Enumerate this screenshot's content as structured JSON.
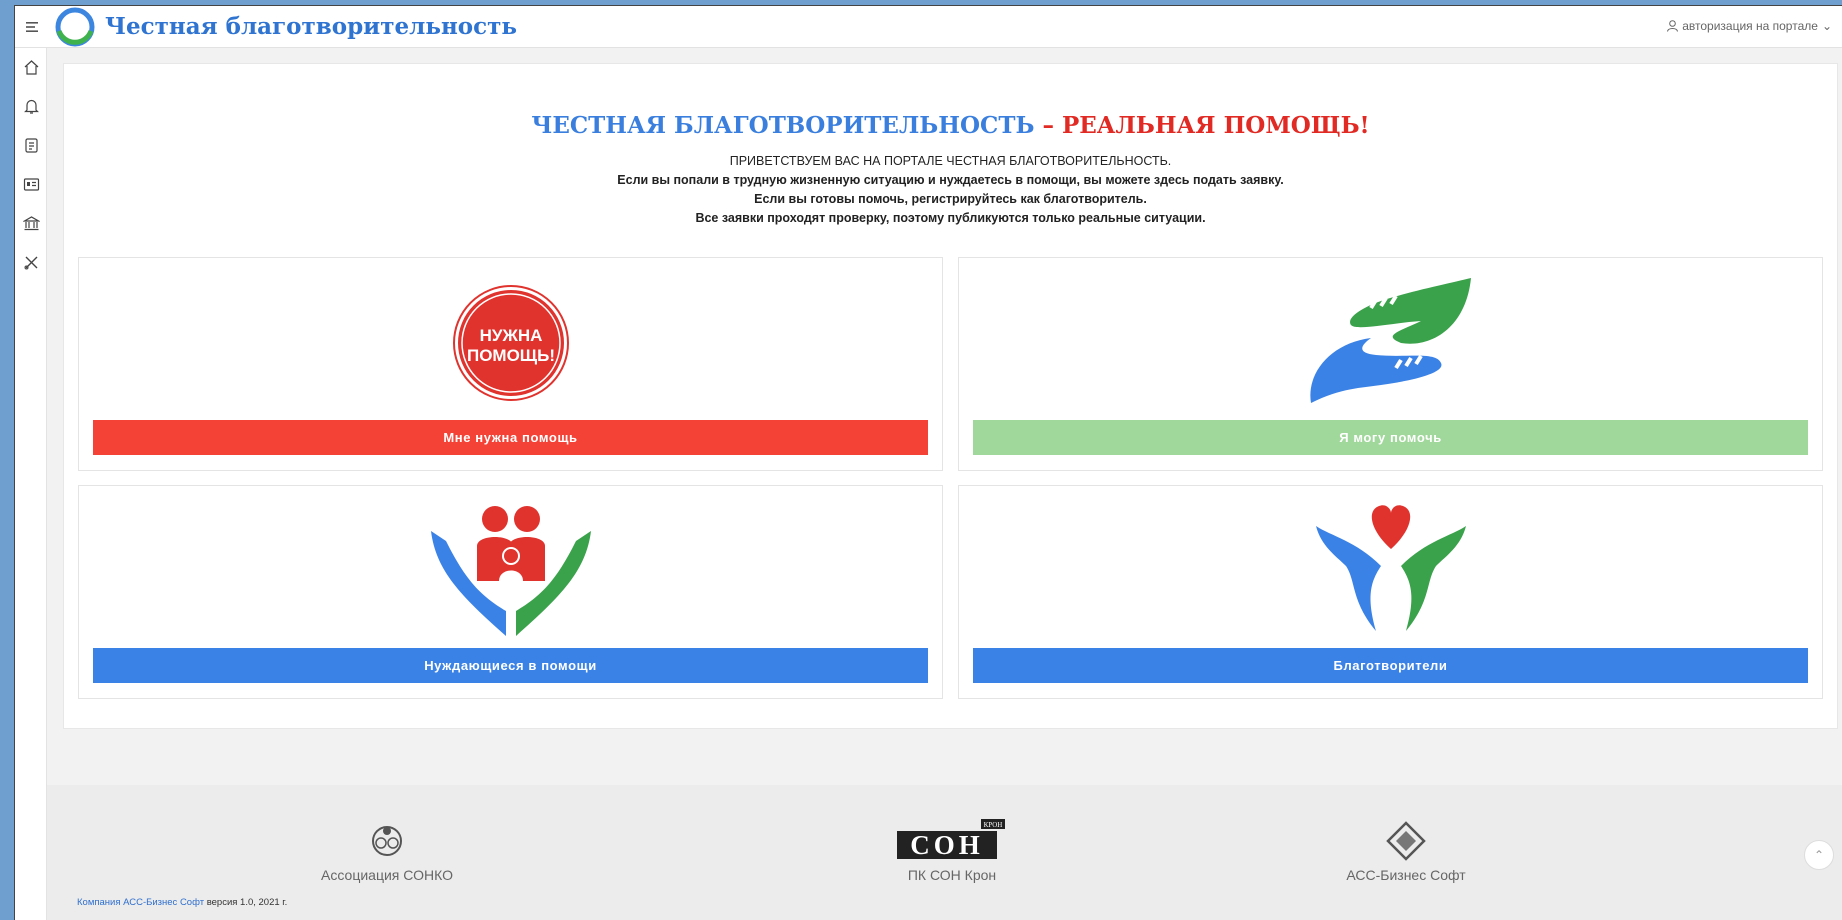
{
  "header": {
    "title": "Честная благотворительность",
    "auth_label": "авторизация на портале"
  },
  "sidebar": {
    "items": [
      {
        "icon": "home-icon"
      },
      {
        "icon": "bell-icon"
      },
      {
        "icon": "document-icon"
      },
      {
        "icon": "id-card-icon"
      },
      {
        "icon": "bank-icon"
      },
      {
        "icon": "tools-icon"
      }
    ]
  },
  "hero": {
    "title_blue": "ЧЕСТНАЯ БЛАГОТВОРИТЕЛЬНОСТЬ",
    "title_dash": " – ",
    "title_red": "РЕАЛЬНАЯ ПОМОЩЬ!",
    "lines": [
      "ПРИВЕТСТВУЕМ ВАС НА ПОРТАЛЕ ЧЕСТНАЯ БЛАГОТВОРИТЕЛЬНОСТЬ.",
      "Если вы попали в трудную жизненную ситуацию и нуждаетесь в помощи, вы можете здесь подать заявку.",
      "Если вы готовы помочь, регистрируйтесь как благотворитель.",
      "Все заявки проходят проверку, поэтому публикуются только реальные ситуации."
    ]
  },
  "cards": [
    {
      "label": "Мне нужна помощь",
      "color": "#f44336",
      "badge_line1": "НУЖНА",
      "badge_line2": "ПОМОЩЬ!"
    },
    {
      "label": "Я могу помочь",
      "color": "#a0d79a"
    },
    {
      "label": "Нуждающиеся в помощи",
      "color": "#3b82e6"
    },
    {
      "label": "Благотворители",
      "color": "#3b82e6"
    }
  ],
  "footer": {
    "items": [
      {
        "label": "Ассоциация СОНКО"
      },
      {
        "label": "ПК СОН Крон",
        "logo_text": "СОН",
        "logo_badge": "КРОН"
      },
      {
        "label": "АСС-Бизнес Софт"
      }
    ],
    "company_link": "Компания АСС-Бизнес Софт",
    "version": "версия 1.0, 2021 г."
  }
}
